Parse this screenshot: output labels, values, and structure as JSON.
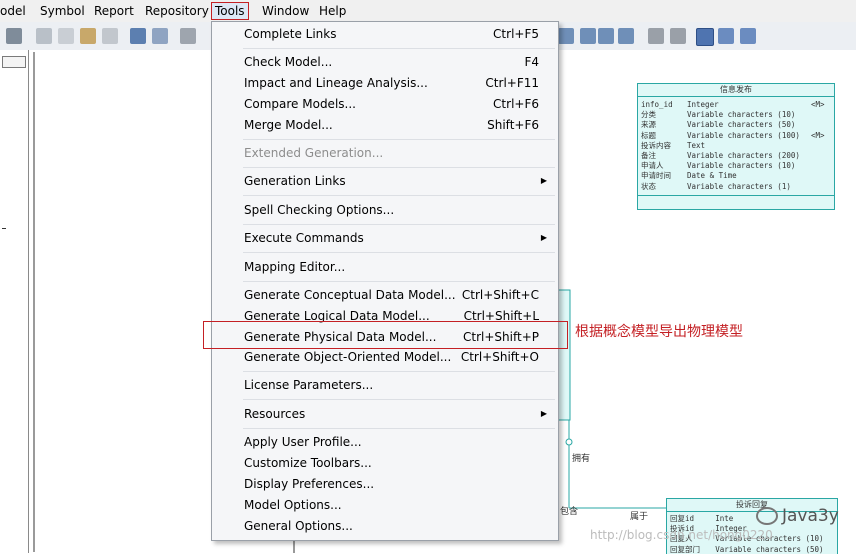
{
  "menubar": [
    "odel",
    "Symbol",
    "Report",
    "Repository",
    "Tools",
    "Window",
    "Help"
  ],
  "menu": {
    "complete_links": {
      "label": "Complete Links",
      "shortcut": "Ctrl+F5"
    },
    "check_model": {
      "label": "Check Model...",
      "shortcut": "F4"
    },
    "impact": {
      "label": "Impact and Lineage Analysis...",
      "shortcut": "Ctrl+F11"
    },
    "compare": {
      "label": "Compare Models...",
      "shortcut": "Ctrl+F6"
    },
    "merge": {
      "label": "Merge Model...",
      "shortcut": "Shift+F6"
    },
    "extended": {
      "label": "Extended Generation..."
    },
    "gen_links": {
      "label": "Generation Links"
    },
    "spell": {
      "label": "Spell Checking Options..."
    },
    "execute": {
      "label": "Execute Commands"
    },
    "mapping": {
      "label": "Mapping Editor..."
    },
    "gen_cdm": {
      "label": "Generate Conceptual Data Model...",
      "shortcut": "Ctrl+Shift+C"
    },
    "gen_ldm": {
      "label": "Generate Logical Data Model...",
      "shortcut": "Ctrl+Shift+L"
    },
    "gen_pdm": {
      "label": "Generate Physical Data Model...",
      "shortcut": "Ctrl+Shift+P"
    },
    "gen_oom": {
      "label": "Generate Object-Oriented Model...",
      "shortcut": "Ctrl+Shift+O"
    },
    "license": {
      "label": "License Parameters..."
    },
    "resources": {
      "label": "Resources"
    },
    "apply_profile": {
      "label": "Apply User Profile..."
    },
    "customize": {
      "label": "Customize Toolbars..."
    },
    "display": {
      "label": "Display Preferences..."
    },
    "model_options": {
      "label": "Model Options..."
    },
    "general_options": {
      "label": "General Options..."
    }
  },
  "annotation": "根据概念模型导出物理模型",
  "entity1": {
    "title": "信息发布",
    "rows": [
      [
        "info_id",
        "Integer",
        "<M>"
      ],
      [
        "分类",
        "Variable characters (10)",
        ""
      ],
      [
        "来源",
        "Variable characters (50)",
        ""
      ],
      [
        "标题",
        "Variable characters (100)",
        "<M>"
      ],
      [
        "投诉内容",
        "Text",
        ""
      ],
      [
        "备注",
        "Variable characters (200)",
        ""
      ],
      [
        "申请人",
        "Variable characters (10)",
        ""
      ],
      [
        "申请时间",
        "Date & Time",
        ""
      ],
      [
        "状态",
        "Variable characters (1)",
        ""
      ]
    ]
  },
  "entity2": {
    "title": "投诉回复",
    "rows": [
      [
        "回复id",
        "Inte",
        ""
      ],
      [
        "投诉id",
        "Integer",
        ""
      ],
      [
        "回复人",
        "Variable characters (10)",
        ""
      ],
      [
        "回复部门",
        "Variable characters (50)",
        ""
      ]
    ]
  },
  "relations": {
    "r1": "拥有",
    "r2": "包含",
    "r3": "属于"
  },
  "watermark": "http://blog.csdn.net/hong0220",
  "brand": "Java3y",
  "colors": {
    "accent": "#c42024",
    "entity_fill": "#dff8f7",
    "entity_border": "#2aa7a4"
  }
}
